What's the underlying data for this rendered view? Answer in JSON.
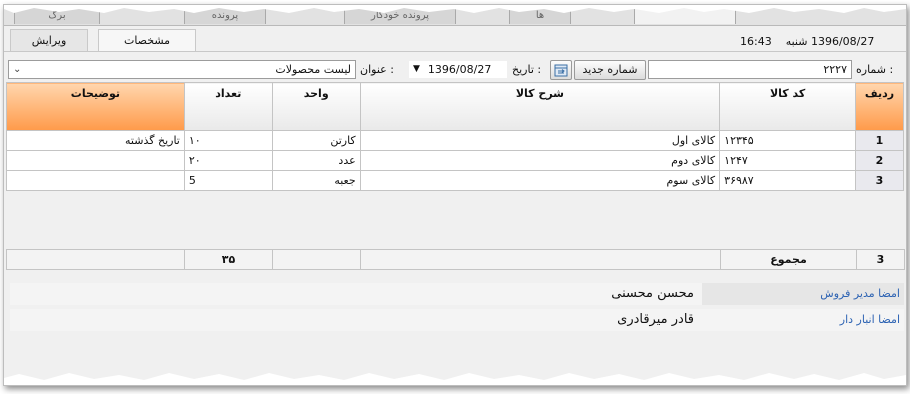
{
  "window": {
    "top_tabs": [
      "برگ",
      "پرونده",
      "پرونده خودکار",
      "ها"
    ],
    "inner_tabs": {
      "active": "مشخصات",
      "inactive": "ویرایش"
    },
    "header_info": {
      "time": "16:43",
      "day": "شنبه",
      "date": "1396/08/27"
    }
  },
  "form": {
    "number_label": "شماره :",
    "number_value": "۲۲۲۷",
    "new_number_button": "شماره جدید",
    "date_label": "تاریخ :",
    "date_value": "1396/08/27",
    "title_label": "عنوان :",
    "title_value": "لیست محصولات",
    "calendar_icon": "calendar-icon",
    "dropdown_icon": "chevron-down-icon"
  },
  "grid": {
    "columns": [
      "ردیف",
      "کد کالا",
      "شرح کالا",
      "واحد",
      "تعداد",
      "توضیحات"
    ],
    "rows": [
      {
        "row": "1",
        "code": "۱۲۳۴۵",
        "desc": "کالای اول",
        "unit": "کارتن",
        "qty": "۱۰",
        "note": "تاریخ گذشته"
      },
      {
        "row": "2",
        "code": "۱۲۴۷",
        "desc": "کالای دوم",
        "unit": "عدد",
        "qty": "۲۰",
        "note": ""
      },
      {
        "row": "3",
        "code": "۳۶۹۸۷",
        "desc": "کالای سوم",
        "unit": "جعبه",
        "qty": "5",
        "note": ""
      }
    ],
    "footer": {
      "row_count": "3",
      "total_label": "مجموع",
      "total_qty": "۳۵"
    }
  },
  "signatures": [
    {
      "label": "امضا مدیر فروش",
      "name": "محسن محسنی"
    },
    {
      "label": "امضا انبار دار",
      "name": "قادر میرقادری"
    }
  ],
  "colors": {
    "header_accent": "#ff9a4a",
    "link_blue": "#2d63b3"
  }
}
